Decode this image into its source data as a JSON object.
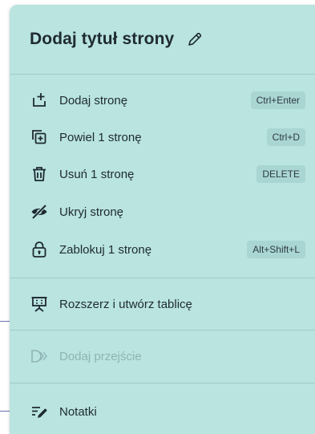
{
  "header": {
    "title": "Dodaj tytuł strony",
    "edit_icon": "pencil-icon"
  },
  "menu": {
    "items": [
      {
        "label": "Dodaj stronę",
        "shortcut": "Ctrl+Enter",
        "icon": "add-page-icon"
      },
      {
        "label": "Powiel 1 stronę",
        "shortcut": "Ctrl+D",
        "icon": "duplicate-page-icon"
      },
      {
        "label": "Usuń 1 stronę",
        "shortcut": "DELETE",
        "icon": "trash-icon"
      },
      {
        "label": "Ukryj stronę",
        "shortcut": "",
        "icon": "eye-off-icon"
      },
      {
        "label": "Zablokuj 1 stronę",
        "shortcut": "Alt+Shift+L",
        "icon": "lock-icon"
      }
    ],
    "expand": {
      "label": "Rozszerz i utwórz tablicę",
      "icon": "presentation-board-icon"
    },
    "transition": {
      "label": "Dodaj przejście",
      "icon": "transition-icon",
      "disabled": true
    },
    "notes": {
      "label": "Notatki",
      "icon": "notes-icon"
    }
  },
  "colors": {
    "panel_bg": "#b9e4e0",
    "text": "#1f2a33",
    "disabled_text": "#8fb3b4",
    "shortcut_bg": "#a9d6d2"
  }
}
